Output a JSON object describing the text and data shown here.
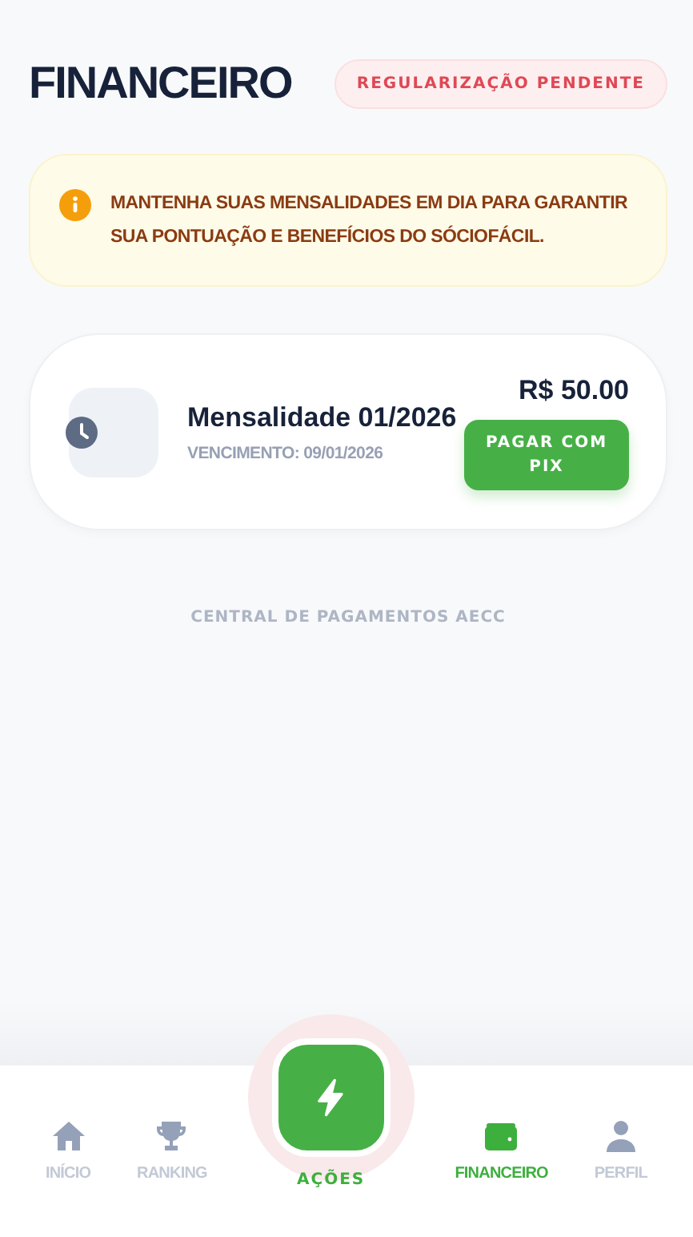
{
  "header": {
    "title": "FINANCEIRO",
    "status_badge": "REGULARIZAÇÃO PENDENTE"
  },
  "alert": {
    "text": "MANTENHA SUAS MENSALIDADES EM DIA PARA GARANTIR SUA PONTUAÇÃO E BENEFÍCIOS DO SÓCIOFÁCIL."
  },
  "payments": [
    {
      "title": "Mensalidade 01/2026",
      "due": "VENCIMENTO: 09/01/2026",
      "amount": "R$ 50.00",
      "button": "PAGAR COM PIX"
    }
  ],
  "footer": "CENTRAL DE PAGAMENTOS AECC",
  "nav": [
    {
      "kind": "home",
      "label": "INÍCIO",
      "selected": false
    },
    {
      "kind": "trophy",
      "label": "RANKING",
      "selected": false
    },
    {
      "kind": "action",
      "label": "AÇÕES",
      "selected": false
    },
    {
      "kind": "wallet",
      "label": "FINANCEIRO",
      "selected": true
    },
    {
      "kind": "person",
      "label": "PERFIL",
      "selected": false
    }
  ]
}
